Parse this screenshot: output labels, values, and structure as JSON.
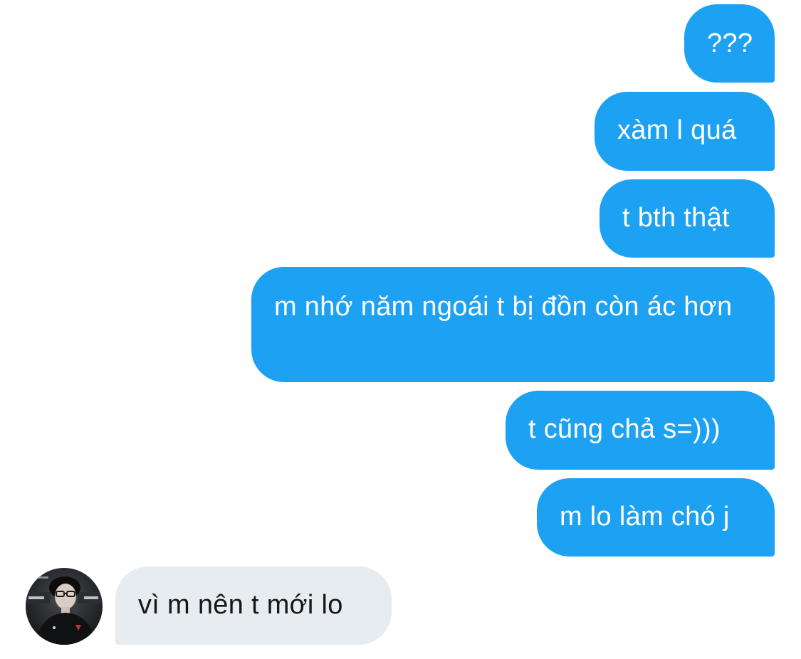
{
  "conversation": {
    "sent_messages": [
      {
        "text": "???"
      },
      {
        "text": "xàm l quá"
      },
      {
        "text": "t bth thật"
      },
      {
        "text": "m nhớ năm ngoái t bị đồn còn ác hơn"
      },
      {
        "text": "t cũng chả s=)))"
      },
      {
        "text": "m lo làm chó j"
      }
    ],
    "received_messages": [
      {
        "text": "vì m nên t mới lo"
      }
    ]
  },
  "colors": {
    "sent_bubble": "#1da1f2",
    "received_bubble": "#e6ecf0",
    "sent_text": "#ffffff",
    "received_text": "#14171a"
  },
  "icons": {
    "avatar": "user-avatar"
  }
}
